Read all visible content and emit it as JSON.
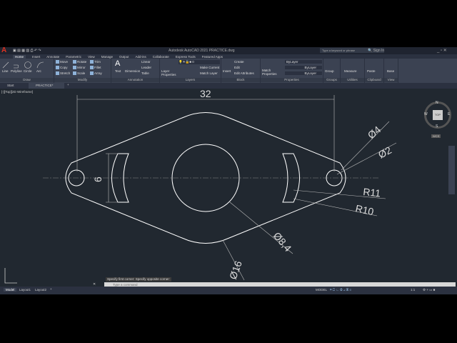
{
  "app": {
    "title": "Autodesk AutoCAD 2021   PRACTICE.dwg",
    "search_placeholder": "Type a keyword or phrase",
    "sign_in": "Sign In",
    "logo": "A"
  },
  "ribbon_tabs": [
    "Home",
    "Insert",
    "Annotate",
    "Parametric",
    "View",
    "Manage",
    "Output",
    "Add-ins",
    "Collaborate",
    "Express Tools",
    "Featured Apps"
  ],
  "panels": {
    "draw": {
      "title": "Draw",
      "items": [
        "Line",
        "Polyline",
        "Circle",
        "Arc"
      ]
    },
    "modify": {
      "title": "Modify",
      "items": [
        "Move",
        "Rotate",
        "Trim",
        "Copy",
        "Mirror",
        "Fillet",
        "Stretch",
        "Scale",
        "Array"
      ]
    },
    "annotation": {
      "title": "Annotation",
      "items": [
        "Text",
        "Dimension",
        "Linear",
        "Leader",
        "Table"
      ]
    },
    "layers": {
      "title": "Layers",
      "items": [
        "Layer Properties",
        "Make Current",
        "Match Layer"
      ],
      "current": "0"
    },
    "block": {
      "title": "Block",
      "items": [
        "Insert",
        "Create",
        "Edit",
        "Edit Attributes"
      ]
    },
    "properties": {
      "title": "Properties",
      "match": "Match Properties",
      "color": "ByLayer",
      "linetype": "ByLayer",
      "lineweight": "ByLayer"
    },
    "groups": {
      "title": "Groups",
      "item": "Group"
    },
    "utilities": {
      "title": "Utilities",
      "item": "Measure"
    },
    "clipboard": {
      "title": "Clipboard",
      "item": "Paste"
    },
    "view": {
      "title": "View",
      "item": "Base"
    }
  },
  "file_tabs": [
    "Start",
    "PRACTICE*"
  ],
  "viewport_label": "[-][Top][2D Wireframe]",
  "viewcube": {
    "top": "TOP",
    "n": "N",
    "s": "S",
    "e": "E",
    "w": "W",
    "wcs": "WCS"
  },
  "dimensions": {
    "width": "32",
    "height": "6",
    "d4": "Ø4",
    "d2": "Ø2",
    "r11": "R11",
    "r10": "R10",
    "d84": "Ø8,4",
    "d16": "Ø16"
  },
  "command": {
    "history": "Specify first corner: Specify opposite corner:",
    "placeholder": "Type a command"
  },
  "layout_tabs": [
    "Model",
    "Layout1",
    "Layout2"
  ],
  "status": {
    "model": "MODEL",
    "scale": "1:1"
  }
}
